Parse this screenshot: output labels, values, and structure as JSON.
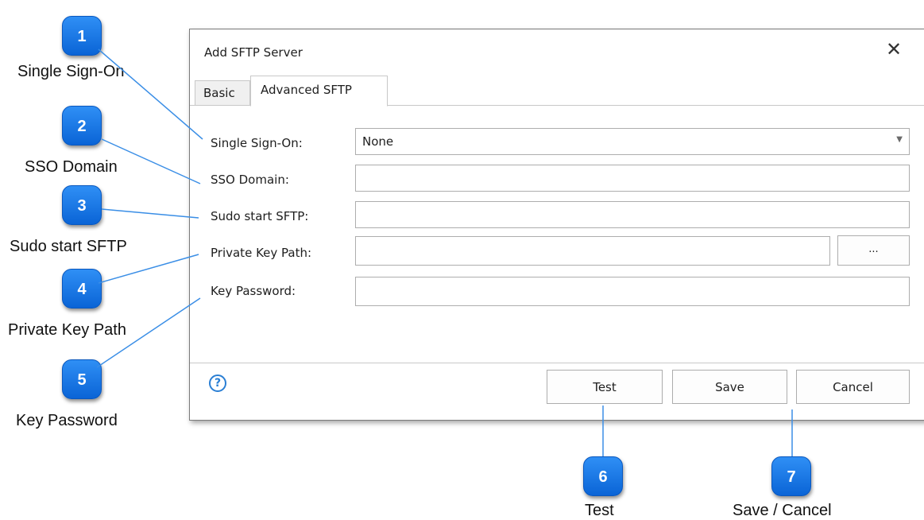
{
  "dialog": {
    "title": "Add SFTP Server",
    "close_icon": "close-icon",
    "tabs": [
      {
        "label": "Basic",
        "selected": false
      },
      {
        "label": "Advanced SFTP",
        "selected": true
      }
    ],
    "fields": {
      "single_sign_on": {
        "label": "Single Sign-On:",
        "value": "None"
      },
      "sso_domain": {
        "label": "SSO Domain:",
        "value": ""
      },
      "sudo_start_sftp": {
        "label": "Sudo start SFTP:",
        "value": ""
      },
      "private_key_path": {
        "label": "Private Key Path:",
        "value": "",
        "browse_label": "..."
      },
      "key_password": {
        "label": "Key Password:",
        "value": ""
      }
    },
    "buttons": {
      "test": "Test",
      "save": "Save",
      "cancel": "Cancel"
    },
    "help_icon": "help-icon"
  },
  "callouts": [
    {
      "number": "1",
      "caption": "Single Sign-On"
    },
    {
      "number": "2",
      "caption": "SSO Domain"
    },
    {
      "number": "3",
      "caption": "Sudo start SFTP"
    },
    {
      "number": "4",
      "caption": "Private Key Path"
    },
    {
      "number": "5",
      "caption": "Key Password"
    },
    {
      "number": "6",
      "caption": "Test"
    },
    {
      "number": "7",
      "caption": "Save / Cancel"
    }
  ],
  "colors": {
    "marker": "#1a78ee",
    "connector": "#3a8ee6",
    "help": "#2a7fd4"
  }
}
